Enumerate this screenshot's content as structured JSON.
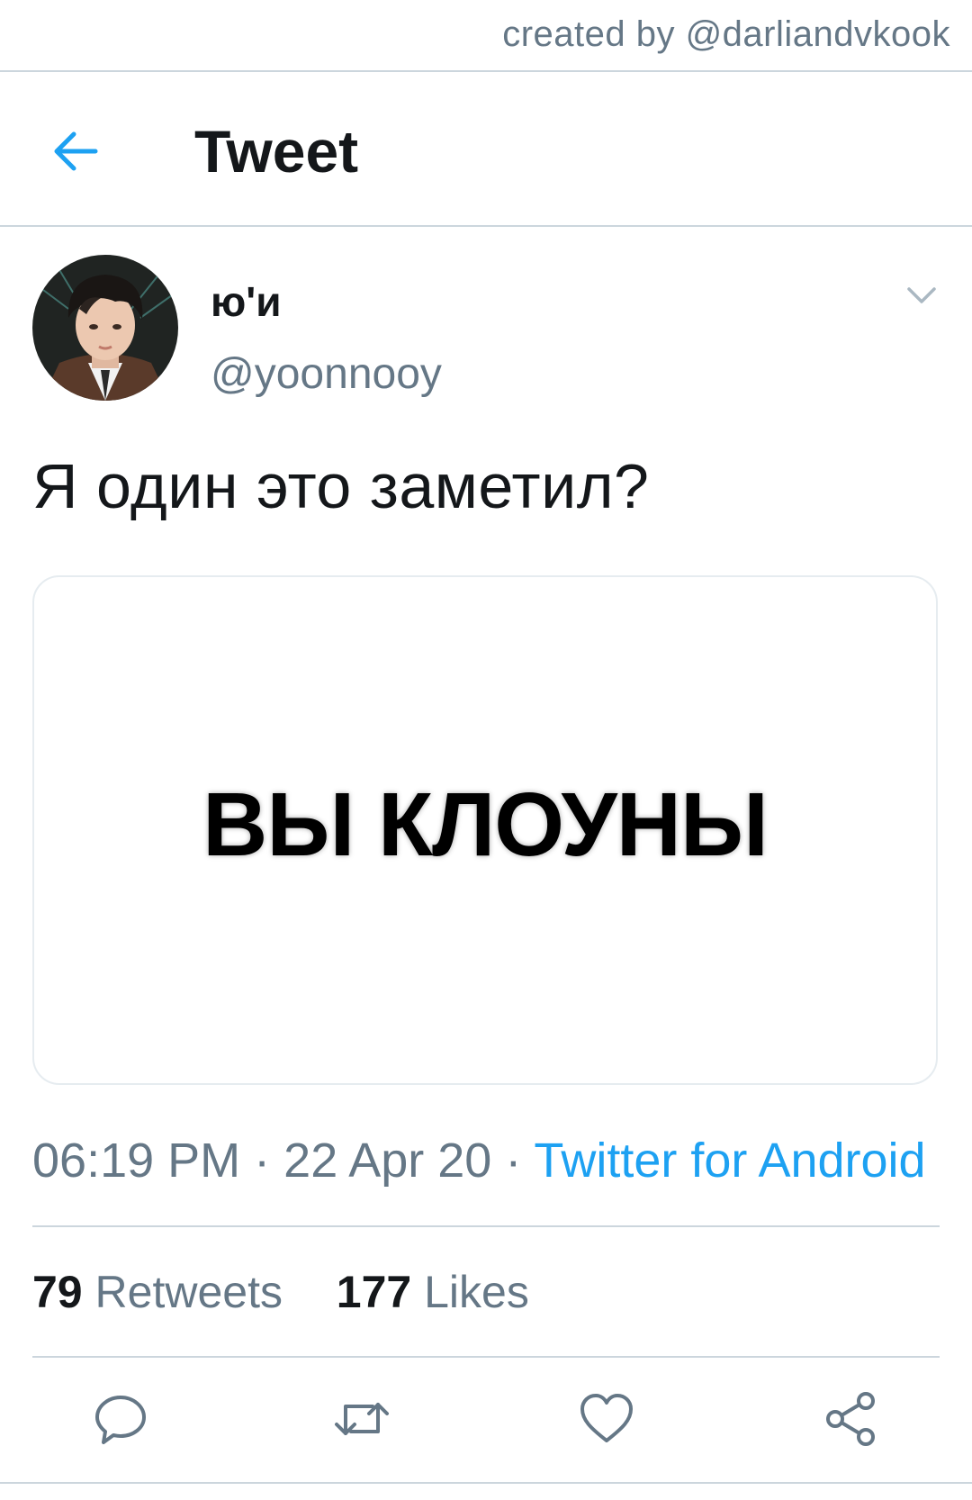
{
  "watermark": {
    "credit": "created by @darliandvkook"
  },
  "header": {
    "title": "Tweet",
    "back_icon": "arrow-left-icon"
  },
  "author": {
    "display_name": "ю'и",
    "handle": "@yoonnooy"
  },
  "tweet": {
    "text": "Я один это заметил?",
    "media_text": "ВЫ КЛОУНЫ"
  },
  "meta": {
    "time": "06:19 PM",
    "separator": "·",
    "date": "22 Apr 20",
    "source": "Twitter for Android"
  },
  "stats": {
    "retweets_count": "79",
    "retweets_label": "Retweets",
    "likes_count": "177",
    "likes_label": "Likes"
  },
  "actions": {
    "icons": [
      "reply-icon",
      "retweet-icon",
      "like-icon",
      "share-icon"
    ]
  },
  "colors": {
    "accent": "#1da1f2",
    "text_primary": "#14171a",
    "text_secondary": "#657786",
    "divider": "#ccd6dd"
  }
}
